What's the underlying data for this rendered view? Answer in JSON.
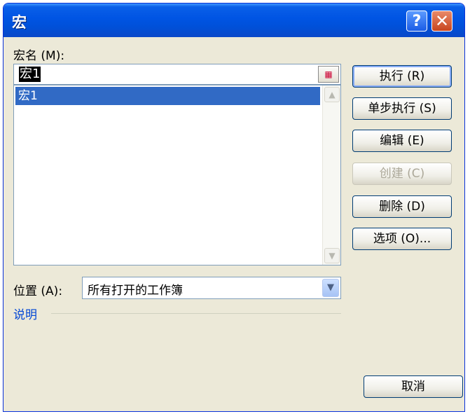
{
  "window": {
    "title": "宏",
    "help_label": "?",
    "close_label": "✕"
  },
  "macro_name": {
    "label": "宏名",
    "label_key": "(M)",
    "label_colon": ":",
    "value": "宏1",
    "ref_icon": "range-picker-icon"
  },
  "macro_list": {
    "items": [
      {
        "label": "宏1",
        "selected": true
      }
    ],
    "scroll_up": "▲",
    "scroll_down": "▼"
  },
  "buttons": {
    "run": {
      "text": "执行",
      "key": "(R)",
      "suffix": ""
    },
    "step": {
      "text": "单步执行",
      "key": "(S)",
      "suffix": ""
    },
    "edit": {
      "text": "编辑",
      "key": "(E)",
      "suffix": ""
    },
    "create": {
      "text": "创建",
      "key": "(C)",
      "suffix": "",
      "disabled": true
    },
    "delete": {
      "text": "删除",
      "key": "(D)",
      "suffix": ""
    },
    "options": {
      "text": "选项",
      "key": "(O)",
      "suffix": "..."
    },
    "cancel": {
      "text": "取消"
    }
  },
  "location": {
    "label": "位置",
    "label_key": "(A)",
    "label_colon": ":",
    "value": "所有打开的工作簿",
    "dropdown_icon": "chevron-down-icon"
  },
  "description": {
    "label": "说明"
  },
  "colors": {
    "titlebar": "#0054e3",
    "selection": "#316ac5",
    "dialog": "#ece9d8",
    "description_label": "#0046d5"
  }
}
